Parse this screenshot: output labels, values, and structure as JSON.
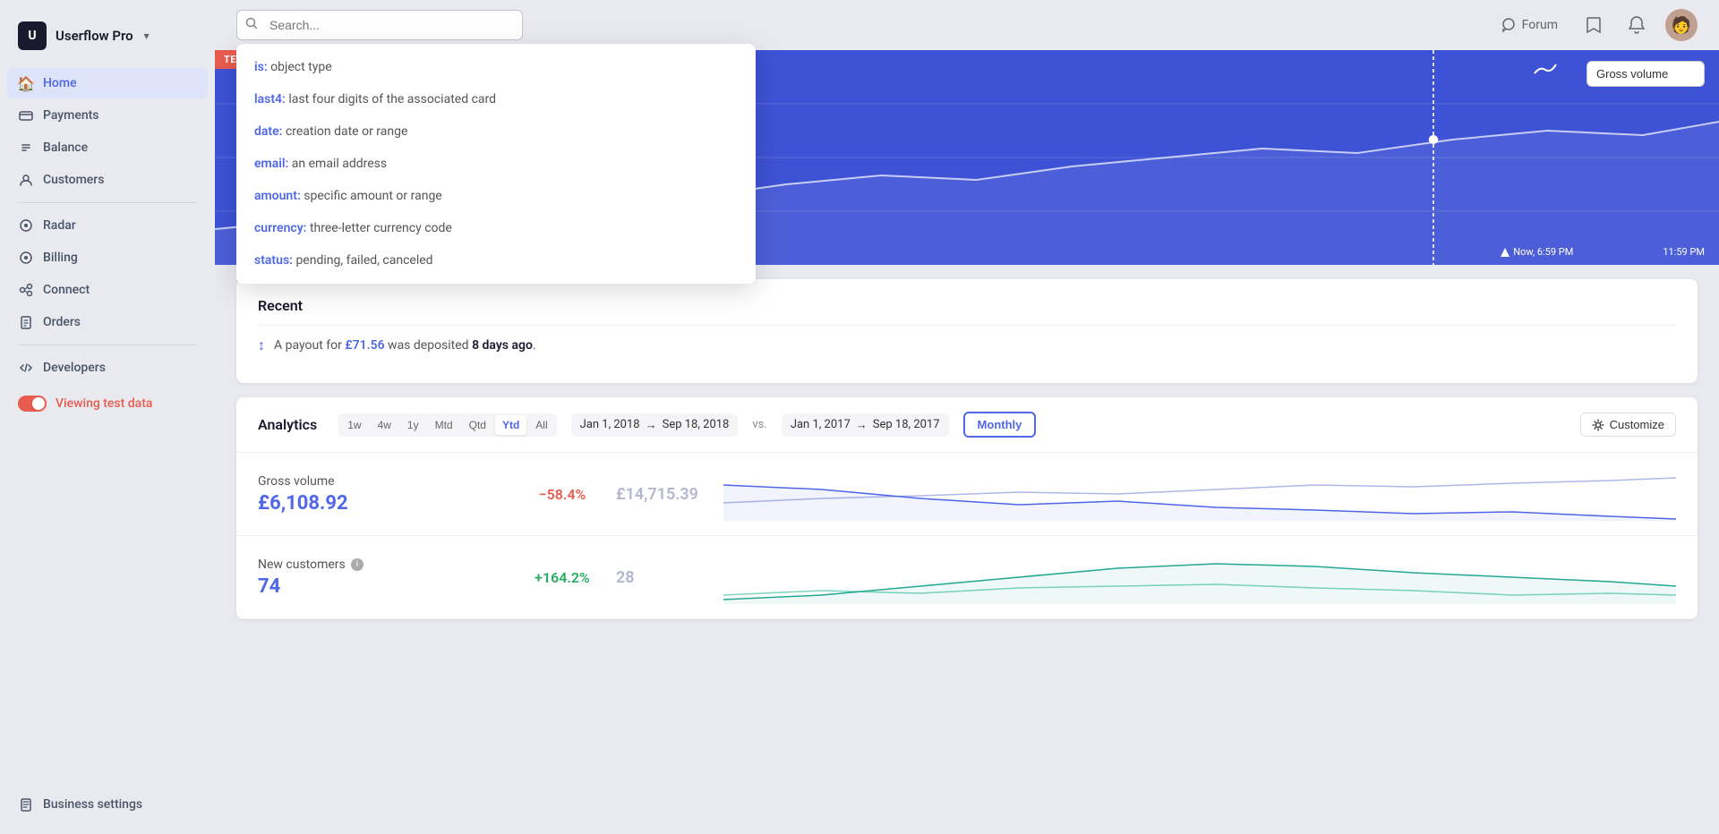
{
  "sidebar": {
    "logo": {
      "text": "Userflow Pro",
      "chevron": "▾"
    },
    "nav_items": [
      {
        "id": "home",
        "label": "Home",
        "icon": "🏠",
        "active": true
      },
      {
        "id": "payments",
        "label": "Payments",
        "icon": "📷",
        "active": false
      },
      {
        "id": "balance",
        "label": "Balance",
        "icon": "⇅",
        "active": false
      },
      {
        "id": "customers",
        "label": "Customers",
        "icon": "👤",
        "active": false
      }
    ],
    "nav_items2": [
      {
        "id": "radar",
        "label": "Radar",
        "icon": "◉",
        "active": false
      },
      {
        "id": "billing",
        "label": "Billing",
        "icon": "●",
        "active": false
      },
      {
        "id": "connect",
        "label": "Connect",
        "icon": "◎",
        "active": false
      },
      {
        "id": "orders",
        "label": "Orders",
        "icon": "🗑",
        "active": false
      }
    ],
    "nav_items3": [
      {
        "id": "developers",
        "label": "Developers",
        "icon": ">_",
        "active": false
      }
    ],
    "viewing_test": "Viewing test data",
    "business_settings": "Business settings"
  },
  "topbar": {
    "search_placeholder": "Search...",
    "forum_label": "Forum",
    "icons": {
      "bookmark": "🔖",
      "bell": "🔔"
    }
  },
  "search_dropdown": {
    "items": [
      {
        "key": "is:",
        "desc": "object type"
      },
      {
        "key": "last4:",
        "desc": "last four digits of the associated card"
      },
      {
        "key": "date:",
        "desc": "creation date or range"
      },
      {
        "key": "email:",
        "desc": "an email address"
      },
      {
        "key": "amount:",
        "desc": "specific amount or range"
      },
      {
        "key": "currency:",
        "desc": "three-letter currency code"
      },
      {
        "key": "status:",
        "desc": "pending, failed, canceled"
      }
    ]
  },
  "hero": {
    "test_data_badge": "TEST DATA",
    "gross_volume_label": "Gross volume",
    "chart_times": [
      "Now, 6:59 PM",
      "11:59 PM"
    ]
  },
  "recent": {
    "title": "Recent",
    "item_text": "A payout for ",
    "amount": "£71.56",
    "item_text2": " was deposited ",
    "time": "8 days ago",
    "item_text3": "."
  },
  "analytics": {
    "title": "Analytics",
    "period_tabs": [
      "1w",
      "4w",
      "1y",
      "Mtd",
      "Qtd",
      "Ytd",
      "All"
    ],
    "active_tab": "Ytd",
    "date_from": "Jan 1, 2018",
    "date_to": "Sep 18, 2018",
    "vs_label": "vs.",
    "compare_from": "Jan 1, 2017",
    "compare_to": "Sep 18, 2017",
    "monthly_label": "Monthly",
    "customize_label": "Customize",
    "metrics": [
      {
        "name": "Gross volume",
        "has_info": false,
        "value": "£6,108.92",
        "change": "−58.4%",
        "change_type": "negative",
        "comparison": "£14,715.39"
      },
      {
        "name": "New customers",
        "has_info": true,
        "value": "74",
        "change": "+164.2%",
        "change_type": "positive",
        "comparison": "28"
      }
    ]
  }
}
